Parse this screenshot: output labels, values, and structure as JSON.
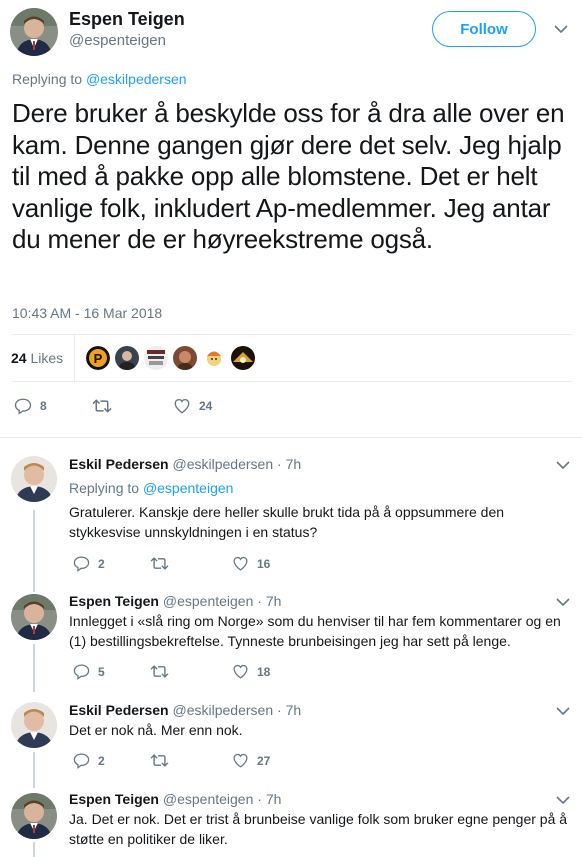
{
  "main_tweet": {
    "author_name": "Espen Teigen",
    "author_handle": "@espenteigen",
    "follow_label": "Follow",
    "replying_prefix": "Replying to",
    "replying_to": "@eskilpedersen",
    "text": "Dere bruker å beskylde oss for å dra alle over en kam. Denne gangen gjør dere det selv. Jeg hjalp til med å pakke opp alle blomstene. Det er helt vanlige folk, inkludert Ap-medlemmer. Jeg antar du mener de er høyreekstreme også.",
    "timestamp": "10:43 AM - 16 Mar 2018",
    "likes_count": "24",
    "likes_label": "Likes",
    "actions": {
      "replies": "8",
      "retweets": "",
      "likes": "24"
    }
  },
  "replies": [
    {
      "name": "Eskil Pedersen",
      "handle": "@eskilpedersen",
      "time": "· 7h",
      "replying_prefix": "Replying to",
      "replying_to": "@espenteigen",
      "text": "Gratulerer. Kanskje dere heller skulle brukt tida på å oppsummere den stykkesvise unnskyldningen i en status?",
      "replies": "2",
      "retweets": "",
      "likes": "16"
    },
    {
      "name": "Espen Teigen",
      "handle": "@espenteigen",
      "time": "· 7h",
      "text": "Innlegget i «slå ring om Norge» som du henviser til har fem kommentarer og en (1) bestillingsbekreftelse. Tynneste brunbeisingen jeg har sett på lenge.",
      "replies": "5",
      "retweets": "",
      "likes": "18"
    },
    {
      "name": "Eskil Pedersen",
      "handle": "@eskilpedersen",
      "time": "· 7h",
      "text": "Det er nok nå. Mer enn nok.",
      "replies": "2",
      "retweets": "",
      "likes": "27"
    },
    {
      "name": "Espen Teigen",
      "handle": "@espenteigen",
      "time": "· 7h",
      "text": "Ja. Det er nok. Det er trist å brunbeise vanlige folk som bruker egne penger på å støtte en politiker de liker."
    }
  ],
  "icons": {
    "reply": "reply-icon",
    "retweet": "retweet-icon",
    "like": "heart-icon",
    "more": "chevron-down-icon"
  },
  "colors": {
    "accent": "#1da1f2",
    "secondary_text": "#657786",
    "primary_text": "#14171a",
    "border": "#e6ecf0"
  }
}
